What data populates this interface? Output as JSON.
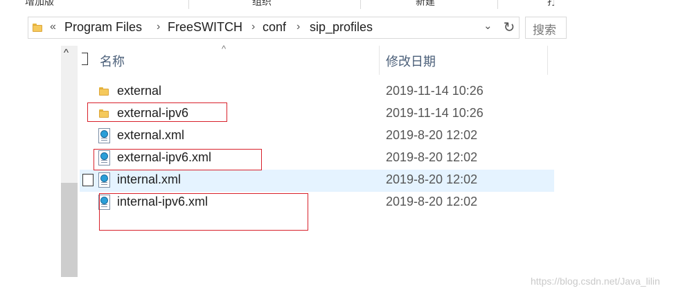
{
  "top_strip": {
    "left": "增加版",
    "mid": "组织",
    "right": "新建",
    "far": "打"
  },
  "address": {
    "crumbs": [
      "Program Files",
      "FreeSWITCH",
      "conf",
      "sip_profiles"
    ],
    "overflow": "«",
    "separator": "›",
    "dropdown": "⌄",
    "refresh": "↻"
  },
  "search": {
    "placeholder": "搜索"
  },
  "nav": {
    "up_arrow": "^"
  },
  "columns": {
    "name": "名称",
    "date": "修改日期",
    "sort_indicator": "^"
  },
  "files": [
    {
      "name": "external",
      "date": "2019-11-14 10:26",
      "type": "folder"
    },
    {
      "name": "external-ipv6",
      "date": "2019-11-14 10:26",
      "type": "folder"
    },
    {
      "name": "external.xml",
      "date": "2019-8-20 12:02",
      "type": "xml"
    },
    {
      "name": "external-ipv6.xml",
      "date": "2019-8-20 12:02",
      "type": "xml"
    },
    {
      "name": "internal.xml",
      "date": "2019-8-20 12:02",
      "type": "xml"
    },
    {
      "name": "internal-ipv6.xml",
      "date": "2019-8-20 12:02",
      "type": "xml"
    }
  ],
  "watermark": "https://blog.csdn.net/Java_lilin"
}
